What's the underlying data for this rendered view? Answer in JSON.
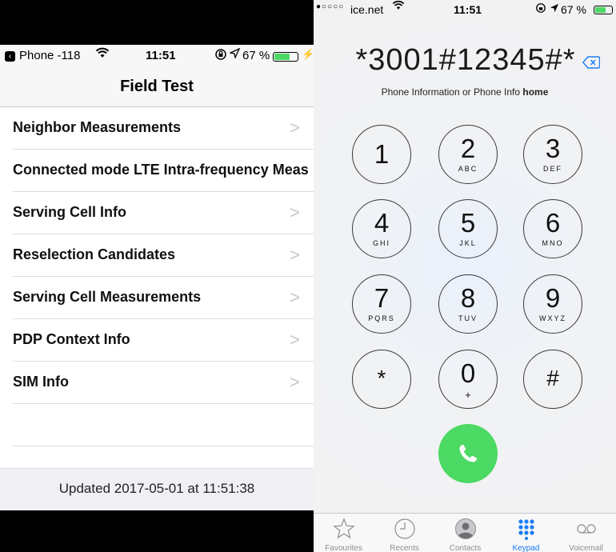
{
  "field_test": {
    "status": {
      "carrier": "Phone -118",
      "time": "11:51",
      "battery_pct": "67 %",
      "battery_level": 0.67
    },
    "title": "Field Test",
    "items": [
      {
        "label": "Neighbor Measurements"
      },
      {
        "label": "Connected mode LTE Intra-frequency Meas"
      },
      {
        "label": "Serving Cell Info"
      },
      {
        "label": "Reselection Candidates"
      },
      {
        "label": "Serving Cell Measurements"
      },
      {
        "label": "PDP Context Info"
      },
      {
        "label": "SIM Info"
      }
    ],
    "chevron": ">",
    "footer": "Updated 2017-05-01 at 11:51:38"
  },
  "dialer": {
    "status": {
      "carrier": "ice.net",
      "time": "11:51",
      "battery_pct": "67 %",
      "battery_level": 0.67
    },
    "number": "*3001#12345#*",
    "info_prefix": "Phone Information or Phone Info ",
    "info_bold": "home",
    "keys": [
      {
        "digit": "1",
        "letters": ""
      },
      {
        "digit": "2",
        "letters": "ABC"
      },
      {
        "digit": "3",
        "letters": "DEF"
      },
      {
        "digit": "4",
        "letters": "GHI"
      },
      {
        "digit": "5",
        "letters": "JKL"
      },
      {
        "digit": "6",
        "letters": "MNO"
      },
      {
        "digit": "7",
        "letters": "PQRS"
      },
      {
        "digit": "8",
        "letters": "TUV"
      },
      {
        "digit": "9",
        "letters": "WXYZ"
      },
      {
        "digit": "*",
        "letters": ""
      },
      {
        "digit": "0",
        "letters": "+"
      },
      {
        "digit": "#",
        "letters": ""
      }
    ],
    "tabs": [
      {
        "label": "Favourites",
        "icon": "star-icon"
      },
      {
        "label": "Recents",
        "icon": "clock-icon"
      },
      {
        "label": "Contacts",
        "icon": "contact-icon"
      },
      {
        "label": "Keypad",
        "icon": "keypad-icon",
        "active": true
      },
      {
        "label": "Voicemail",
        "icon": "voicemail-icon"
      }
    ],
    "colors": {
      "call_green": "#4cd964",
      "active_tab": "#1a7cf5",
      "backspace_blue": "#1a7cf5"
    }
  }
}
